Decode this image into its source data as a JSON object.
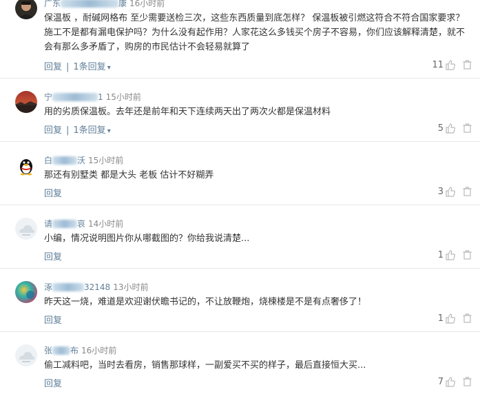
{
  "comments": [
    {
      "name_visible": "广东",
      "name_tail": "康",
      "time": "16小时前",
      "text": "保温板 ，耐碱网格布 至少需要送检三次，这些东西质量到底怎样？ 保温板被引燃这符合不符合国家要求？施工不是都有漏电保护吗？为什么没有起作用？人家花这么多钱买个房子不容易，你们应该解释清楚，就不会有那么多矛盾了，购房的市民估计不会轻易就算了",
      "reply_label": "回复",
      "replies_label": "1条回复",
      "likes": "11",
      "avatar": "man-portrait"
    },
    {
      "name_visible": "宁",
      "name_tail": "1",
      "time": "15小时前",
      "text": "用的劣质保温板。去年还是前年和天下连续两天出了两次火都是保温材料",
      "reply_label": "回复",
      "replies_label": "1条回复",
      "likes": "5",
      "avatar": "sunset-landscape"
    },
    {
      "name_visible": "白",
      "name_tail": "沃",
      "time": "15小时前",
      "text": "那还有别墅类 都是大头 老板 估计不好糊弄",
      "reply_label": "回复",
      "replies_label": "",
      "likes": "3",
      "avatar": "qq-penguin"
    },
    {
      "name_visible": "请",
      "name_tail": "哀",
      "time": "14小时前",
      "text": "小编，情况说明图片你从哪截图的？你给我说清楚...",
      "reply_label": "回复",
      "replies_label": "",
      "likes": "1",
      "avatar": "default-cloud"
    },
    {
      "name_visible": "涿",
      "name_tail": "32148",
      "time": "13小时前",
      "text": "昨天这一烧，难道是欢迎谢伏瞻书记的，不让放鞭炮，烧楝楼是不是有点奢侈了！",
      "reply_label": "回复",
      "replies_label": "",
      "likes": "1",
      "avatar": "colorful-circle"
    },
    {
      "name_visible": "张",
      "name_tail": "布",
      "time": "16小时前",
      "text": "偷工减料吧，当时去看房，销售那球样，一副爱买不买的样子，最后直接恒大买...",
      "reply_label": "回复",
      "replies_label": "",
      "likes": "7",
      "avatar": "default-cloud"
    }
  ],
  "colors": {
    "link": "#5f7f99",
    "text": "#333333",
    "muted": "#888888",
    "divider": "#e8e8e8"
  }
}
